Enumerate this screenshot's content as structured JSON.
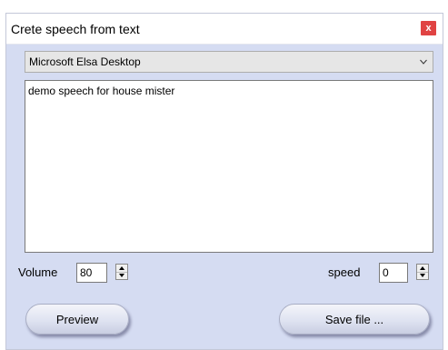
{
  "window": {
    "title": "Crete speech from text",
    "close_label": "x"
  },
  "voice_select": {
    "selected": "Microsoft Elsa Desktop"
  },
  "text_area": {
    "value": "demo speech for house mister"
  },
  "volume": {
    "label": "Volume",
    "value": "80"
  },
  "speed": {
    "label": "speed",
    "value": "0"
  },
  "buttons": {
    "preview": "Preview",
    "save": "Save file ..."
  },
  "colors": {
    "window_bg": "#d5dcf2",
    "close_red": "#e04343"
  }
}
